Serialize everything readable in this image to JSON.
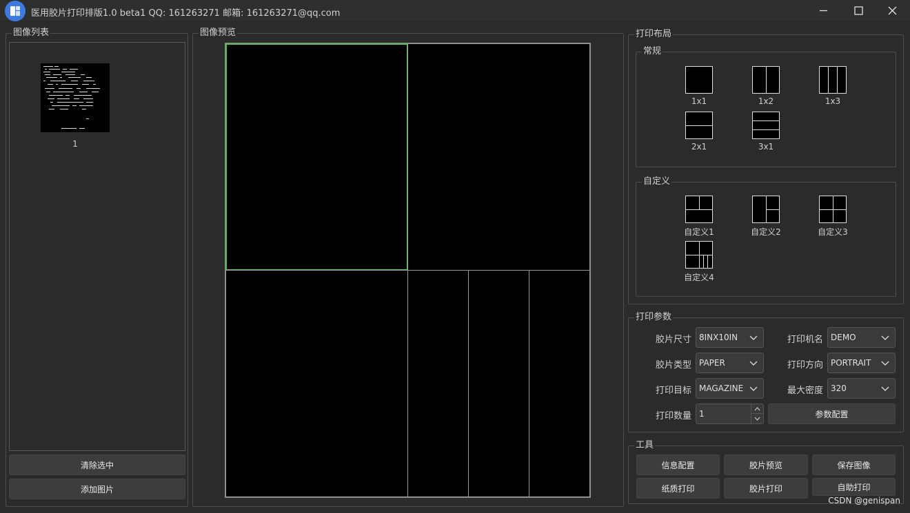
{
  "window": {
    "title": "医用胶片打印排版1.0 beta1 QQ: 161263271 邮箱: 161263271@qq.com",
    "icons": {
      "minimize": "minimize-icon",
      "maximize": "maximize-icon",
      "close": "close-icon"
    }
  },
  "left_panel": {
    "title": "图像列表",
    "images": [
      {
        "label": "1"
      }
    ],
    "clear_button": "清除选中",
    "add_button": "添加图片"
  },
  "preview": {
    "title": "图像预览",
    "selected_cell": 1
  },
  "layout": {
    "title": "打印布局",
    "standard": {
      "title": "常规",
      "items": [
        {
          "label": "1x1",
          "icon": "layout-1x1-icon"
        },
        {
          "label": "1x2",
          "icon": "layout-1x2-icon"
        },
        {
          "label": "1x3",
          "icon": "layout-1x3-icon"
        },
        {
          "label": "2x1",
          "icon": "layout-2x1-icon"
        },
        {
          "label": "3x1",
          "icon": "layout-3x1-icon"
        }
      ]
    },
    "custom": {
      "title": "自定义",
      "items": [
        {
          "label": "自定义1",
          "icon": "layout-custom1-icon"
        },
        {
          "label": "自定义2",
          "icon": "layout-custom2-icon"
        },
        {
          "label": "自定义3",
          "icon": "layout-custom3-icon"
        },
        {
          "label": "自定义4",
          "icon": "layout-custom4-icon"
        }
      ]
    }
  },
  "params": {
    "title": "打印参数",
    "film_size": {
      "label": "胶片尺寸",
      "value": "8INX10IN"
    },
    "printer_name": {
      "label": "打印机名",
      "value": "DEMO"
    },
    "film_type": {
      "label": "胶片类型",
      "value": "PAPER"
    },
    "orientation": {
      "label": "打印方向",
      "value": "PORTRAIT"
    },
    "target": {
      "label": "打印目标",
      "value": "MAGAZINE"
    },
    "max_density": {
      "label": "最大密度",
      "value": "320"
    },
    "copies": {
      "label": "打印数量",
      "value": "1"
    },
    "config_button": "参数配置"
  },
  "tools": {
    "title": "工具",
    "buttons": [
      "信息配置",
      "胶片预览",
      "保存图像",
      "纸质打印",
      "胶片打印",
      "自助打印"
    ]
  },
  "watermark": "CSDN @genispan"
}
